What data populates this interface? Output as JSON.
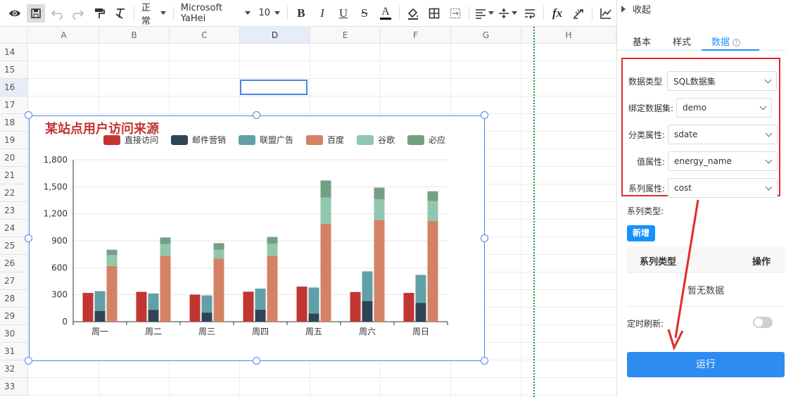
{
  "toolbar": {
    "style_select": "正常",
    "font_select": "Microsoft YaHei",
    "size_select": "10",
    "bold": "B",
    "italic": "I",
    "underline": "U",
    "strike": "S",
    "font_color": "A",
    "fx": "fx"
  },
  "sheet": {
    "columns": [
      "A",
      "B",
      "C",
      "D",
      "E",
      "F",
      "G",
      "H"
    ],
    "rows": [
      "14",
      "15",
      "16",
      "17",
      "18",
      "19",
      "20",
      "21",
      "22",
      "23",
      "24",
      "25",
      "26",
      "27",
      "28",
      "29",
      "30",
      "31",
      "32",
      "33"
    ]
  },
  "chart_data": {
    "type": "bar",
    "title": "某站点用户访问来源",
    "categories": [
      "周一",
      "周二",
      "周三",
      "周四",
      "周五",
      "周六",
      "周日"
    ],
    "ylim": [
      0,
      1800
    ],
    "yticks": [
      "0",
      "300",
      "600",
      "900",
      "1,200",
      "1,500",
      "1,800"
    ],
    "legend_position": "top",
    "series": [
      {
        "name": "直接访问",
        "color": "#c23531",
        "stack": null,
        "values": [
          320,
          332,
          301,
          334,
          390,
          330,
          320
        ]
      },
      {
        "name": "邮件营销",
        "color": "#2f4554",
        "stack": "ad",
        "values": [
          120,
          132,
          101,
          134,
          90,
          230,
          210
        ]
      },
      {
        "name": "联盟广告",
        "color": "#61a0a8",
        "stack": "ad",
        "values": [
          220,
          182,
          191,
          234,
          290,
          330,
          310
        ]
      },
      {
        "name": "百度",
        "color": "#d48265",
        "stack": "search",
        "values": [
          620,
          732,
          701,
          734,
          1090,
          1130,
          1120
        ]
      },
      {
        "name": "谷歌",
        "color": "#91c7ae",
        "stack": "search",
        "values": [
          120,
          132,
          101,
          134,
          290,
          230,
          220
        ]
      },
      {
        "name": "必应",
        "color": "#749f83",
        "stack": "search",
        "values": [
          60,
          72,
          71,
          74,
          190,
          130,
          110
        ]
      }
    ]
  },
  "panel": {
    "collapse_label": "收起",
    "tabs": [
      "基本",
      "样式",
      "数据"
    ],
    "help_icon": "?",
    "fields": [
      {
        "label": "数据类型",
        "value": "SQL数据集"
      },
      {
        "label": "绑定数据集:",
        "value": "demo"
      },
      {
        "label": "分类属性:",
        "value": "sdate"
      },
      {
        "label": "值属性:",
        "value": "energy_name"
      },
      {
        "label": "系列属性:",
        "value": "cost"
      }
    ],
    "series_type_label": "系列类型:",
    "add_button": "新增",
    "table_headers": [
      "系列类型",
      "操作"
    ],
    "empty_text": "暂无数据",
    "refresh_label": "定时刷新:",
    "run_button": "运行",
    "colors": {
      "primary": "#2d8cf0",
      "highlight_border": "#e02b2b",
      "arrow": "#e02b2b"
    }
  }
}
